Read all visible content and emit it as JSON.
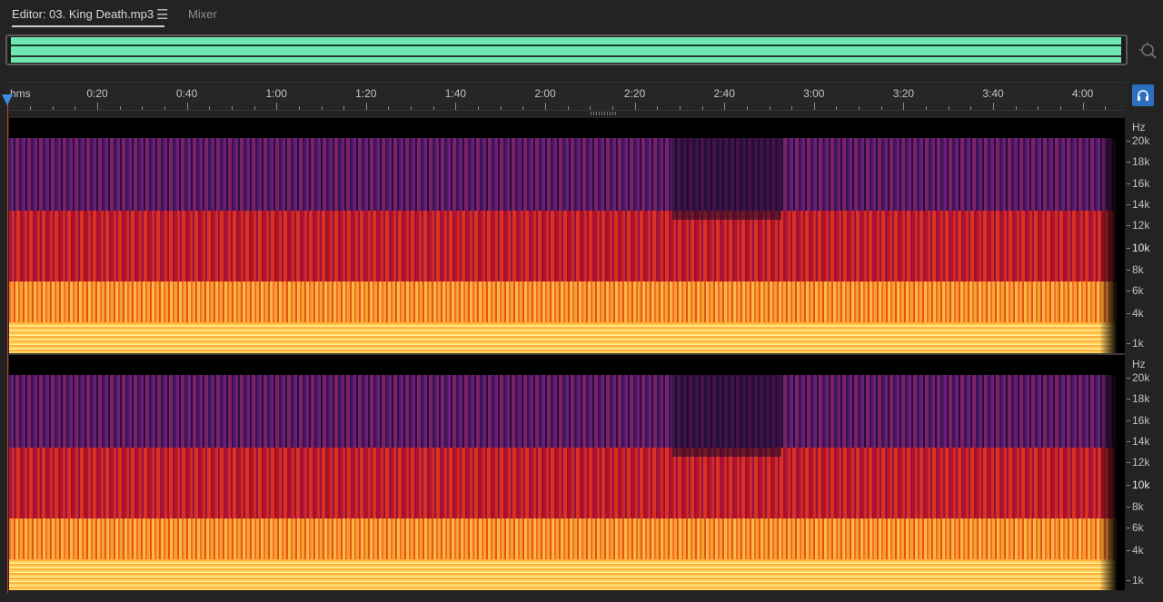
{
  "tabs": {
    "editor_label": "Editor: 03. King Death.mp3",
    "menu_glyph": "☰",
    "mixer_label": "Mixer"
  },
  "overview": {
    "wave_color": "#6ee8b0",
    "zoom_icon": "zoom-to-selection-icon"
  },
  "timeline": {
    "unit": "hms",
    "labels": [
      "0:20",
      "0:40",
      "1:00",
      "1:20",
      "1:40",
      "2:00",
      "2:20",
      "2:40",
      "3:00",
      "3:20",
      "3:40",
      "4:00"
    ]
  },
  "playhead": {
    "time": "0:00",
    "color": "#3c8ee0"
  },
  "headphone_button": {
    "icon": "headphones-icon",
    "color": "#2d6fbf"
  },
  "frequency_axis": {
    "unit": "Hz",
    "labels": [
      "20k",
      "18k",
      "16k",
      "14k",
      "12k",
      "10k",
      "8k",
      "6k",
      "4k",
      "1k"
    ]
  },
  "spectral_colors": [
    "#000000",
    "#6b1f7a",
    "#d22a22",
    "#f8a030",
    "#ffd460"
  ]
}
